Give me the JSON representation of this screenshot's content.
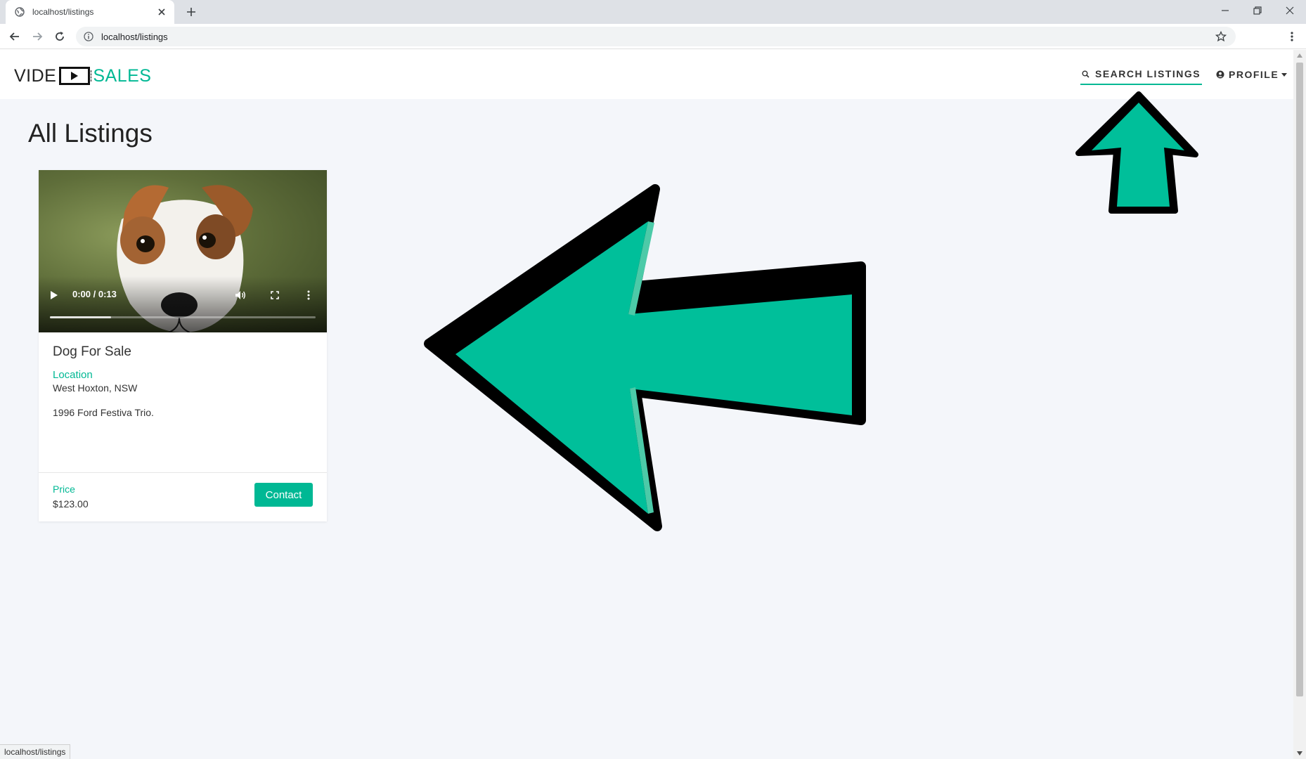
{
  "browser": {
    "tab_title": "localhost/listings",
    "url": "localhost/listings",
    "status_url": "localhost/listings"
  },
  "site": {
    "logo_left": "VIDE",
    "logo_right": "SALES",
    "nav": {
      "search_label": "SEARCH LISTINGS",
      "profile_label": "PROFILE"
    }
  },
  "page": {
    "title": "All Listings"
  },
  "listing": {
    "title": "Dog For Sale",
    "location_label": "Location",
    "location_value": "West Hoxton, NSW",
    "description": "1996 Ford Festiva Trio.",
    "price_label": "Price",
    "price_value": "$123.00",
    "contact_label": "Contact",
    "video": {
      "time": "0:00 / 0:13",
      "progress_fraction": 0.23
    }
  },
  "colors": {
    "accent": "#00b894",
    "page_bg": "#f4f6fa"
  },
  "icons": [
    "globe-icon",
    "close-icon",
    "plus-icon",
    "minimize-icon",
    "restore-icon",
    "back-icon",
    "forward-icon",
    "reload-icon",
    "info-icon",
    "star-icon",
    "kebab-icon",
    "search-icon",
    "user-icon",
    "play-icon",
    "volume-icon",
    "fullscreen-icon"
  ]
}
